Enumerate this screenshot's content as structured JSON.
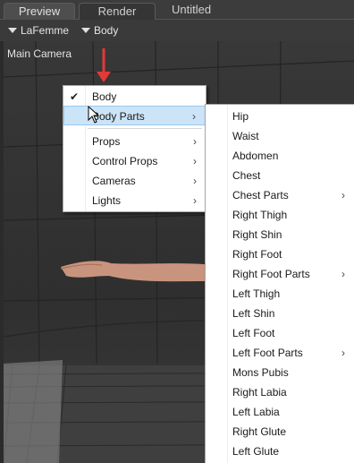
{
  "tabs": [
    {
      "label": "Preview",
      "active": true
    },
    {
      "label": "Render",
      "active": false
    }
  ],
  "tab_title": "Untitled",
  "toolbar": {
    "figure_dropdown": "LaFemme",
    "node_dropdown": "Body"
  },
  "viewport": {
    "camera_label": "Main Camera"
  },
  "menu": {
    "checked_label": "Body",
    "items": [
      {
        "label": "Body",
        "checked": true,
        "submenu": false
      },
      {
        "label": "Body Parts",
        "checked": false,
        "submenu": true,
        "highlighted": true
      },
      {
        "label": "Props",
        "checked": false,
        "submenu": true
      },
      {
        "label": "Control Props",
        "checked": false,
        "submenu": true
      },
      {
        "label": "Cameras",
        "checked": false,
        "submenu": true
      },
      {
        "label": "Lights",
        "checked": false,
        "submenu": true
      }
    ]
  },
  "submenu": {
    "items": [
      {
        "label": "Hip",
        "submenu": false
      },
      {
        "label": "Waist",
        "submenu": false
      },
      {
        "label": "Abdomen",
        "submenu": false
      },
      {
        "label": "Chest",
        "submenu": false
      },
      {
        "label": "Chest Parts",
        "submenu": true
      },
      {
        "label": "Right Thigh",
        "submenu": false
      },
      {
        "label": "Right Shin",
        "submenu": false
      },
      {
        "label": "Right Foot",
        "submenu": false
      },
      {
        "label": "Right Foot Parts",
        "submenu": true
      },
      {
        "label": "Left Thigh",
        "submenu": false
      },
      {
        "label": "Left Shin",
        "submenu": false
      },
      {
        "label": "Left Foot",
        "submenu": false
      },
      {
        "label": "Left Foot Parts",
        "submenu": true
      },
      {
        "label": "Mons Pubis",
        "submenu": false
      },
      {
        "label": "Right Labia",
        "submenu": false
      },
      {
        "label": "Left Labia",
        "submenu": false
      },
      {
        "label": "Right Glute",
        "submenu": false
      },
      {
        "label": "Left Glute",
        "submenu": false
      }
    ]
  },
  "icons": {
    "check": "check-icon",
    "submenu_arrow": "chevron-right-icon",
    "dropdown": "triangle-down-icon",
    "annotation": "red-arrow-icon",
    "cursor": "mouse-pointer-icon"
  },
  "colors": {
    "highlight": "#cce4f7",
    "annotation_arrow": "#e53935"
  }
}
